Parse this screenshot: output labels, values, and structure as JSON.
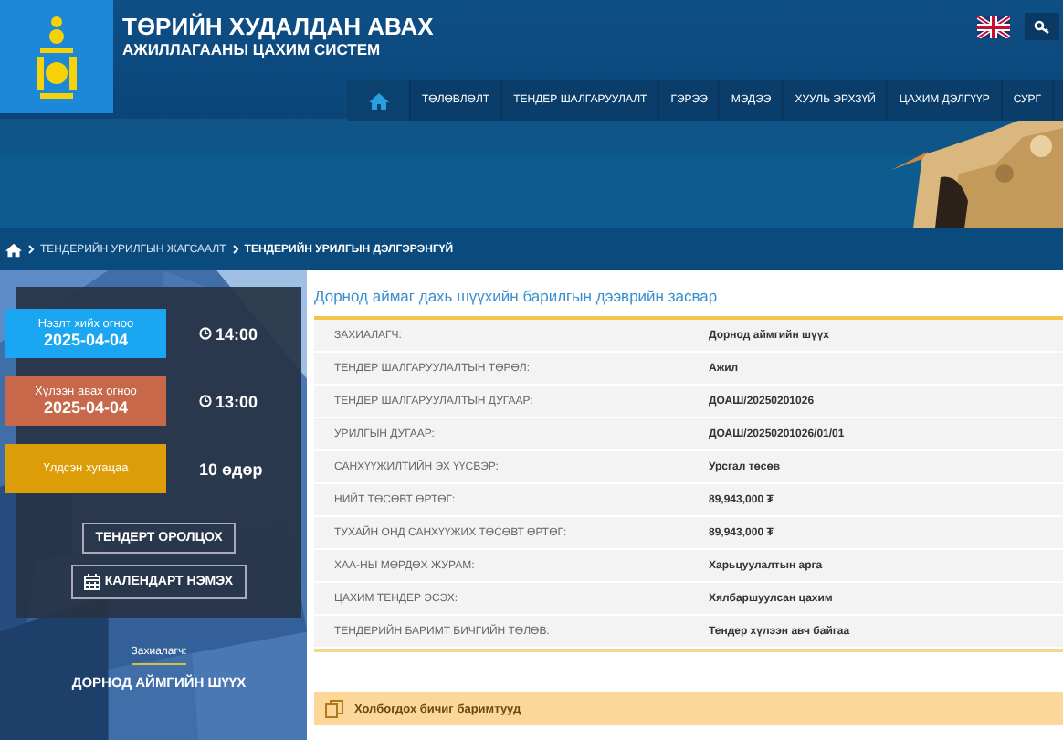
{
  "header": {
    "title": "ТӨРИЙН ХУДАЛДАН АВАХ",
    "subtitle": "АЖИЛЛАГААНЫ ЦАХИМ СИСТЕМ"
  },
  "nav": [
    {
      "label": "ТӨЛӨВЛӨЛТ"
    },
    {
      "label": "ТЕНДЕР ШАЛГАРУУЛАЛТ"
    },
    {
      "label": "ГЭРЭЭ"
    },
    {
      "label": "МЭДЭЭ"
    },
    {
      "label": "ХУУЛЬ ЭРХЗҮЙ"
    },
    {
      "label": "ЦАХИМ ДЭЛГҮҮР"
    },
    {
      "label": "СУРГ"
    }
  ],
  "breadcrumb": [
    {
      "label": "ТЕНДЕРИЙН УРИЛГЫН ЖАГСААЛТ",
      "current": false
    },
    {
      "label": "ТЕНДЕРИЙН УРИЛГЫН ДЭЛГЭРЭНГҮЙ",
      "current": true
    }
  ],
  "dates": [
    {
      "kind": "date",
      "label": "Нээлт хийх огноо",
      "date": "2025-04-04",
      "time": "14:00",
      "color": "#1aa6f0"
    },
    {
      "kind": "date",
      "label": "Хүлээн авах огноо",
      "date": "2025-04-04",
      "time": "13:00",
      "color": "#c8684a"
    },
    {
      "kind": "remaining",
      "label": "Үлдсэн хугацаа",
      "value": "10 өдөр",
      "color": "#dc9d08"
    }
  ],
  "buttons": [
    {
      "label": "ТЕНДЕРТ ОРОЛЦОХ",
      "icon": false
    },
    {
      "label": "КАЛЕНДАРТ НЭМЭХ",
      "icon": true
    }
  ],
  "customer": {
    "label": "Захиалагч:",
    "name": "ДОРНОД АЙМГИЙН ШҮҮХ"
  },
  "tender": {
    "title": "Дорнод аймаг дахь шүүхийн барилгын дээврийн засвар",
    "rows": [
      {
        "label": "ЗАХИАЛАГЧ:",
        "value": "Дорнод аймгийн шүүх"
      },
      {
        "label": "ТЕНДЕР ШАЛГАРУУЛАЛТЫН ТӨРӨЛ:",
        "value": "Ажил"
      },
      {
        "label": "ТЕНДЕР ШАЛГАРУУЛАЛТЫН ДУГААР:",
        "value": "ДОАШ/20250201026"
      },
      {
        "label": "УРИЛГЫН ДУГААР:",
        "value": "ДОАШ/20250201026/01/01"
      },
      {
        "label": "САНХҮҮЖИЛТИЙН ЭХ ҮҮСВЭР:",
        "value": "Урсгал төсөв"
      },
      {
        "label": "НИЙТ ТӨСӨВТ ӨРТӨГ:",
        "value": "89,943,000 ₮"
      },
      {
        "label": "ТУХАЙН ОНД САНХҮҮЖИХ ТӨСӨВТ ӨРТӨГ:",
        "value": "89,943,000 ₮"
      },
      {
        "label": "ХАА-НЫ МӨРДӨХ ЖУРАМ:",
        "value": "Харьцуулалтын арга"
      },
      {
        "label": "ЦАХИМ ТЕНДЕР ЭСЭХ:",
        "value": "Хялбаршуулсан цахим"
      },
      {
        "label": "ТЕНДЕРИЙН БАРИМТ БИЧГИЙН ТӨЛӨВ:",
        "value": "Тендер хүлээн авч байгаа"
      }
    ]
  },
  "documents": {
    "title": "Холбогдох бичиг баримтууд"
  }
}
